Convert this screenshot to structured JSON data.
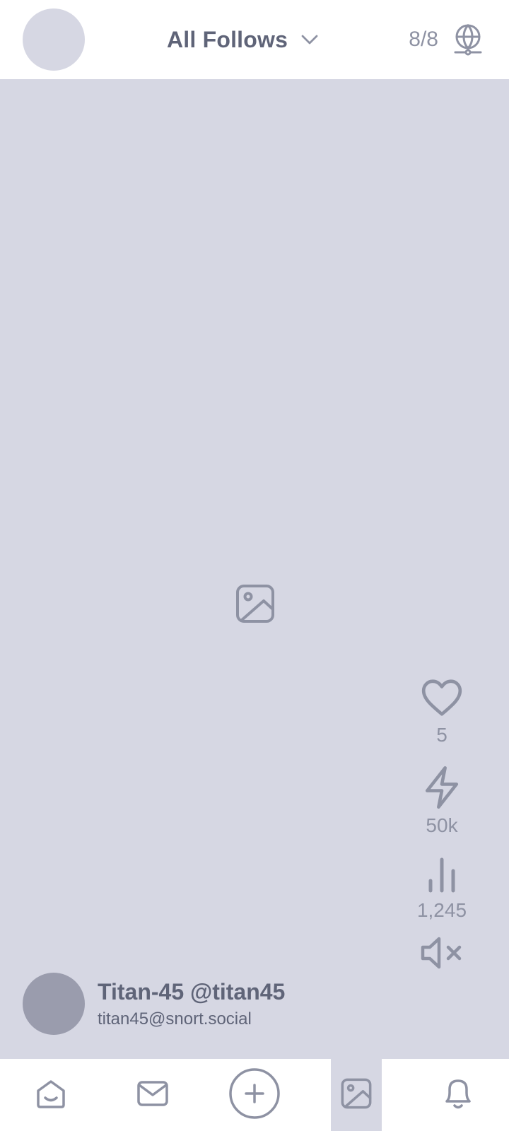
{
  "header": {
    "feed_title": "All Follows",
    "relay_count": "8/8",
    "icons": {
      "dropdown": "chevron-down-icon",
      "relays": "globe-icon"
    }
  },
  "post": {
    "author_name": "Titan-45",
    "author_handle": "@titan45",
    "author_line": "Titan-45 @titan45",
    "nip05": "titan45@snort.social",
    "likes": "5",
    "zaps": "50k",
    "views": "1,245",
    "media_icon": "image-icon",
    "muted": true
  },
  "nav": {
    "items": [
      "home-icon",
      "mail-icon",
      "add-icon",
      "image-icon",
      "bell-icon"
    ]
  },
  "colors": {
    "background": "#ffffff",
    "media_bg": "#d6d7e3",
    "text": "#5f6478",
    "icon": "#8e92a3"
  }
}
